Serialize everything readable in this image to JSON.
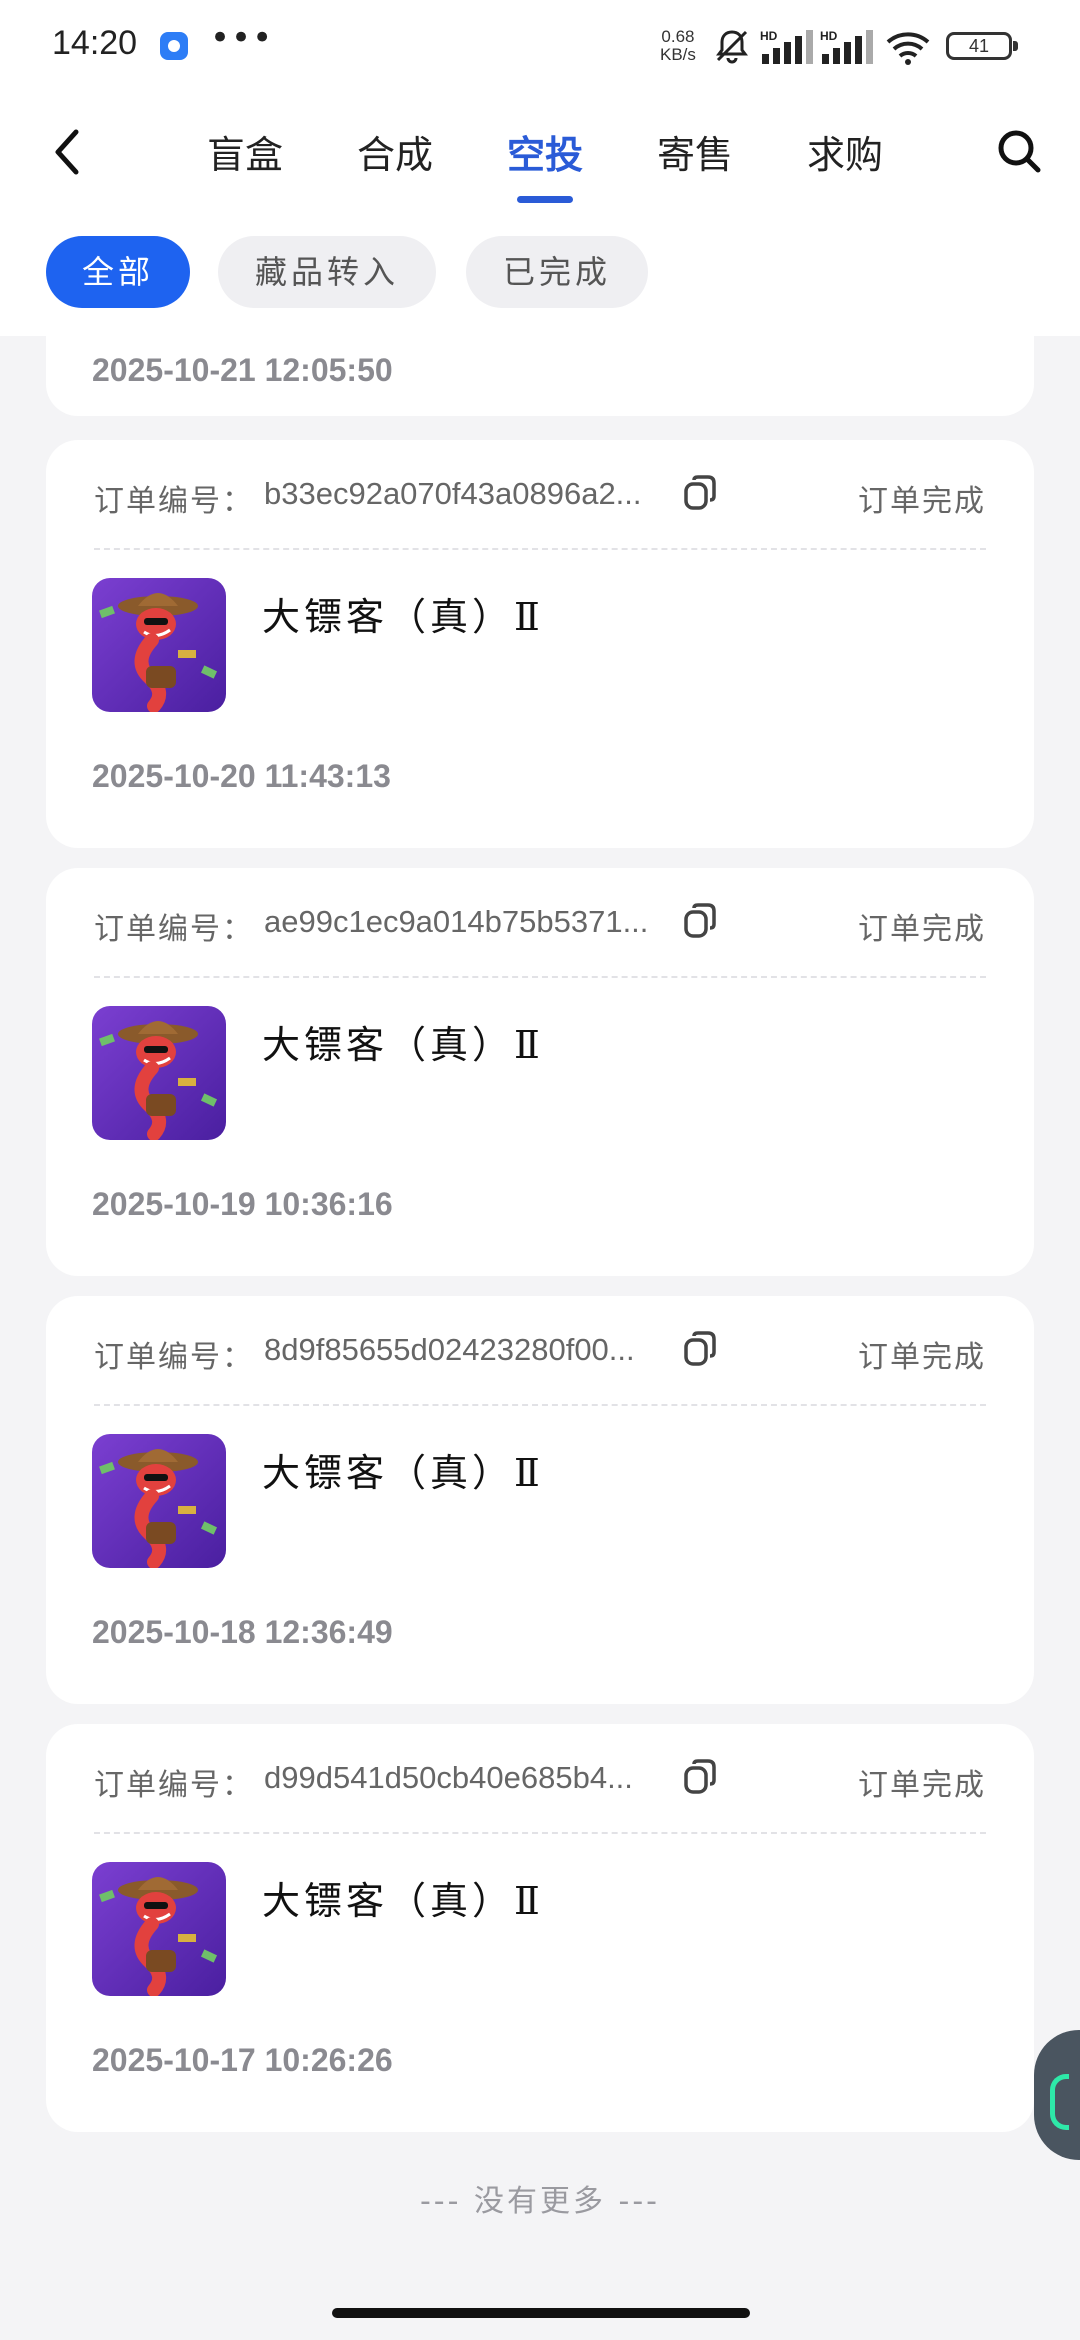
{
  "status_bar": {
    "time": "14:20",
    "more": "•••",
    "net_speed_value": "0.68",
    "net_speed_unit": "KB/s",
    "battery": "41",
    "signal_labels": [
      "HD",
      "HD"
    ]
  },
  "nav": {
    "tabs": [
      {
        "label": "盲盒"
      },
      {
        "label": "合成"
      },
      {
        "label": "空投",
        "active": true
      },
      {
        "label": "寄售"
      },
      {
        "label": "求购"
      }
    ]
  },
  "filters": [
    {
      "label": "全部",
      "active": true
    },
    {
      "label": "藏品转入"
    },
    {
      "label": "已完成"
    }
  ],
  "orders": {
    "partial_date": "2025-10-21 12:05:50",
    "order_label": "订单编号：",
    "items": [
      {
        "id": "b33ec92a070f43a0896a2...",
        "status": "订单完成",
        "name": "大镖客（真）Ⅱ",
        "date": "2025-10-20 11:43:13"
      },
      {
        "id": "ae99c1ec9a014b75b5371...",
        "status": "订单完成",
        "name": "大镖客（真）Ⅱ",
        "date": "2025-10-19 10:36:16"
      },
      {
        "id": "8d9f85655d02423280f00...",
        "status": "订单完成",
        "name": "大镖客（真）Ⅱ",
        "date": "2025-10-18 12:36:49"
      },
      {
        "id": "d99d541d50cb40e685b4...",
        "status": "订单完成",
        "name": "大镖客（真）Ⅱ",
        "date": "2025-10-17 10:26:26"
      }
    ]
  },
  "footer": {
    "no_more": "--- 没有更多 ---"
  },
  "colors": {
    "accent": "#2a5bd7",
    "chip_active": "#1e63f0",
    "background": "#f4f4f6"
  },
  "icons": [
    "back-arrow-icon",
    "search-icon",
    "copy-icon",
    "mute-icon",
    "wifi-icon",
    "signal-icon",
    "battery-icon"
  ]
}
